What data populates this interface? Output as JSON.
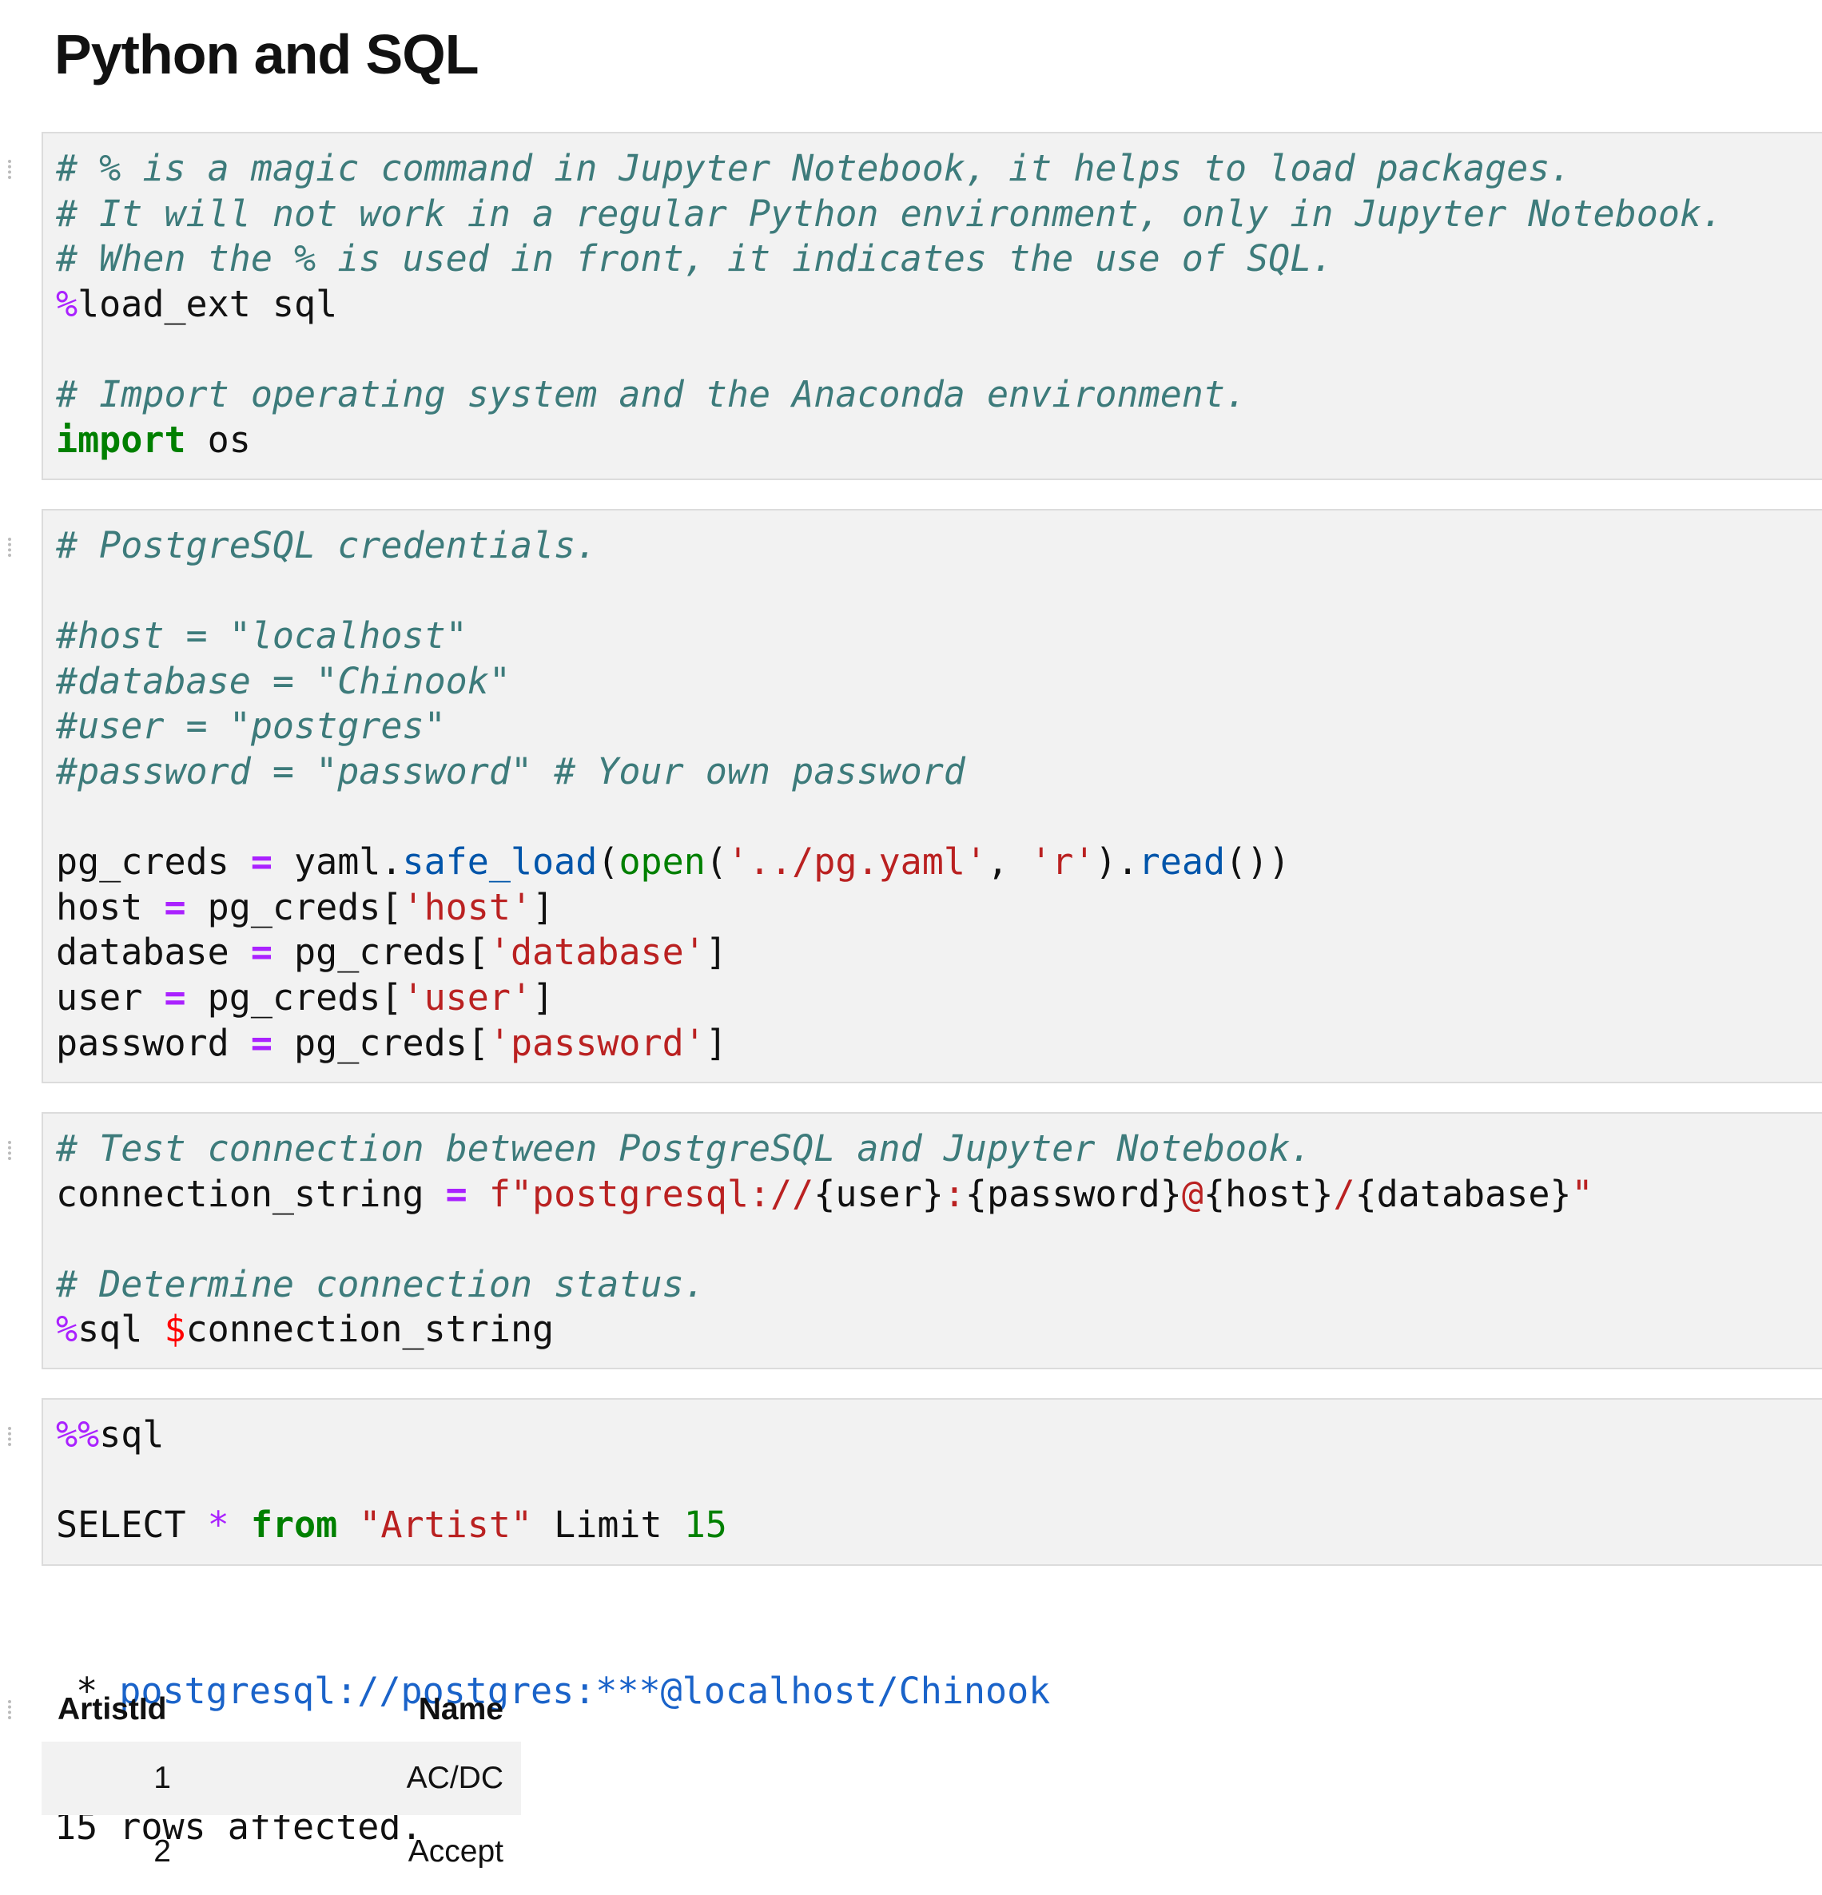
{
  "title": "Python and SQL",
  "cells": [
    {
      "lines": [
        [
          {
            "t": "# % is a magic command in Jupyter Notebook, it helps to load packages.",
            "c": "c"
          }
        ],
        [
          {
            "t": "# It will not work in a regular Python environment, only in Jupyter Notebook.",
            "c": "c"
          }
        ],
        [
          {
            "t": "# When the % is used in front, it indicates the use of SQL.",
            "c": "c"
          }
        ],
        [
          {
            "t": "%",
            "c": "m"
          },
          {
            "t": "load_ext sql",
            "c": "p"
          }
        ],
        [],
        [
          {
            "t": "# Import operating system and the Anaconda environment.",
            "c": "c"
          }
        ],
        [
          {
            "t": "import",
            "c": "k"
          },
          {
            "t": " os",
            "c": "p"
          }
        ]
      ]
    },
    {
      "lines": [
        [
          {
            "t": "# PostgreSQL credentials.",
            "c": "c"
          }
        ],
        [],
        [
          {
            "t": "#host = \"localhost\"",
            "c": "c"
          }
        ],
        [
          {
            "t": "#database = \"Chinook\"",
            "c": "c"
          }
        ],
        [
          {
            "t": "#user = \"postgres\"",
            "c": "c"
          }
        ],
        [
          {
            "t": "#password = \"password\" # Your own password",
            "c": "c"
          }
        ],
        [],
        [
          {
            "t": "pg_creds ",
            "c": "p"
          },
          {
            "t": "=",
            "c": "o"
          },
          {
            "t": " yaml.",
            "c": "p"
          },
          {
            "t": "safe_load",
            "c": "f"
          },
          {
            "t": "(",
            "c": "p"
          },
          {
            "t": "open",
            "c": "b"
          },
          {
            "t": "(",
            "c": "p"
          },
          {
            "t": "'../pg.yaml'",
            "c": "s"
          },
          {
            "t": ", ",
            "c": "p"
          },
          {
            "t": "'r'",
            "c": "s"
          },
          {
            "t": ").",
            "c": "p"
          },
          {
            "t": "read",
            "c": "f"
          },
          {
            "t": "())",
            "c": "p"
          }
        ],
        [
          {
            "t": "host ",
            "c": "p"
          },
          {
            "t": "=",
            "c": "o"
          },
          {
            "t": " pg_creds[",
            "c": "p"
          },
          {
            "t": "'host'",
            "c": "s"
          },
          {
            "t": "]",
            "c": "p"
          }
        ],
        [
          {
            "t": "database ",
            "c": "p"
          },
          {
            "t": "=",
            "c": "o"
          },
          {
            "t": " pg_creds[",
            "c": "p"
          },
          {
            "t": "'database'",
            "c": "s"
          },
          {
            "t": "]",
            "c": "p"
          }
        ],
        [
          {
            "t": "user ",
            "c": "p"
          },
          {
            "t": "=",
            "c": "o"
          },
          {
            "t": " pg_creds[",
            "c": "p"
          },
          {
            "t": "'user'",
            "c": "s"
          },
          {
            "t": "]",
            "c": "p"
          }
        ],
        [
          {
            "t": "password ",
            "c": "p"
          },
          {
            "t": "=",
            "c": "o"
          },
          {
            "t": " pg_creds[",
            "c": "p"
          },
          {
            "t": "'password'",
            "c": "s"
          },
          {
            "t": "]",
            "c": "p"
          }
        ]
      ]
    },
    {
      "lines": [
        [
          {
            "t": "# Test connection between PostgreSQL and Jupyter Notebook.",
            "c": "c"
          }
        ],
        [
          {
            "t": "connection_string ",
            "c": "p"
          },
          {
            "t": "=",
            "c": "o"
          },
          {
            "t": " ",
            "c": "p"
          },
          {
            "t": "f\"postgresql://",
            "c": "s"
          },
          {
            "t": "{user}",
            "c": "p"
          },
          {
            "t": ":",
            "c": "s"
          },
          {
            "t": "{password}",
            "c": "p"
          },
          {
            "t": "@",
            "c": "s"
          },
          {
            "t": "{host}",
            "c": "p"
          },
          {
            "t": "/",
            "c": "s"
          },
          {
            "t": "{database}",
            "c": "p"
          },
          {
            "t": "\"",
            "c": "s"
          }
        ],
        [],
        [
          {
            "t": "# Determine connection status.",
            "c": "c"
          }
        ],
        [
          {
            "t": "%",
            "c": "m"
          },
          {
            "t": "sql ",
            "c": "p"
          },
          {
            "t": "$",
            "c": "d"
          },
          {
            "t": "connection_string",
            "c": "p"
          }
        ]
      ]
    },
    {
      "lines": [
        [
          {
            "t": "%%",
            "c": "m"
          },
          {
            "t": "sql",
            "c": "p"
          }
        ],
        [],
        [
          {
            "t": "SELECT ",
            "c": "p"
          },
          {
            "t": "*",
            "c": "m"
          },
          {
            "t": " ",
            "c": "p"
          },
          {
            "t": "from",
            "c": "k"
          },
          {
            "t": " ",
            "c": "p"
          },
          {
            "t": "\"Artist\"",
            "c": "s"
          },
          {
            "t": " Limit ",
            "c": "p"
          },
          {
            "t": "15",
            "c": "n"
          }
        ]
      ]
    }
  ],
  "output": {
    "bullet": " * ",
    "connection": "postgresql://postgres:***@localhost/Chinook",
    "status": "15 rows affected.",
    "table": {
      "headers": [
        "ArtistId",
        "Name"
      ],
      "rows": [
        [
          "1",
          "AC/DC"
        ],
        [
          "2",
          "Accept"
        ]
      ]
    }
  }
}
